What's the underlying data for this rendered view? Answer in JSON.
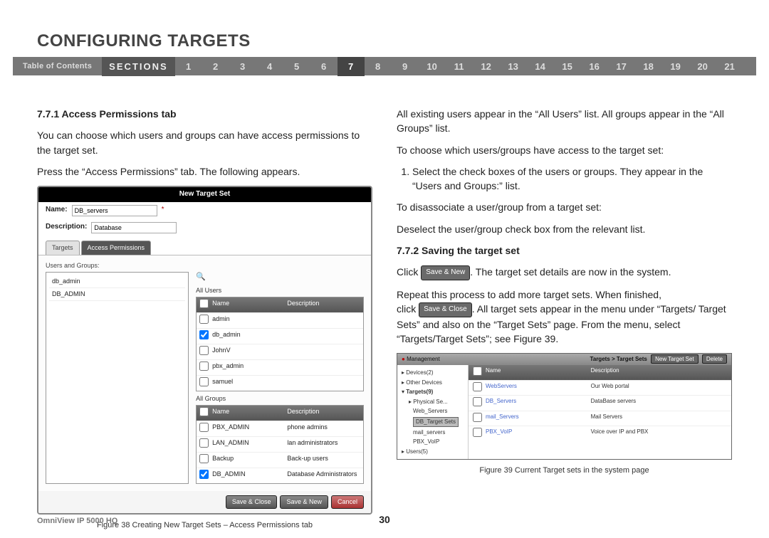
{
  "page_title": "CONFIGURING TARGETS",
  "nav": {
    "toc": "Table of Contents",
    "sections_label": "SECTIONS",
    "numbers": [
      "1",
      "2",
      "3",
      "4",
      "5",
      "6",
      "7",
      "8",
      "9",
      "10",
      "11",
      "12",
      "13",
      "14",
      "15",
      "16",
      "17",
      "18",
      "19",
      "20",
      "21"
    ],
    "active": "7"
  },
  "left": {
    "heading": "7.7.1 Access Permissions tab",
    "p1": "You can choose which users and groups can have access permissions to the target set.",
    "p2": "Press the “Access Permissions” tab. The following appears."
  },
  "fig38": {
    "titlebar": "New Target Set",
    "name_label": "Name:",
    "name_value": "DB_servers",
    "desc_label": "Description:",
    "desc_value": "Database",
    "tab_targets": "Targets",
    "tab_access": "Access Permissions",
    "users_and_groups_label": "Users and Groups:",
    "left_list": [
      "db_admin",
      "DB_ADMIN"
    ],
    "all_users_label": "All Users",
    "cols": {
      "name": "Name",
      "desc": "Description"
    },
    "all_users": [
      {
        "checked": false,
        "name": "admin",
        "desc": ""
      },
      {
        "checked": true,
        "name": "db_admin",
        "desc": ""
      },
      {
        "checked": false,
        "name": "JohnV",
        "desc": ""
      },
      {
        "checked": false,
        "name": "pbx_admin",
        "desc": ""
      },
      {
        "checked": false,
        "name": "samuel",
        "desc": ""
      }
    ],
    "all_groups_label": "All Groups",
    "all_groups": [
      {
        "checked": false,
        "name": "PBX_ADMIN",
        "desc": "phone admins"
      },
      {
        "checked": false,
        "name": "LAN_ADMIN",
        "desc": "lan administrators"
      },
      {
        "checked": false,
        "name": "Backup",
        "desc": "Back-up users"
      },
      {
        "checked": true,
        "name": "DB_ADMIN",
        "desc": "Database Administrators"
      }
    ],
    "buttons": {
      "save_close": "Save & Close",
      "save_new": "Save & New",
      "cancel": "Cancel"
    },
    "caption": "Figure 38 Creating New Target Sets – Access Permissions tab"
  },
  "right": {
    "p1": "All existing users appear in the “All Users” list. All groups appear in the “All Groups” list.",
    "p2": "To choose which users/groups have access to the target set:",
    "step1": "Select the check boxes of the users or groups. They appear in the “Users and Groups:” list.",
    "p3": "To disassociate a user/group from a target set:",
    "p4": "Deselect the user/group check box from the relevant list.",
    "heading2": "7.7.2 Saving the target set",
    "click_word": "Click",
    "save_new_btn": "Save & New",
    "after_save_new": ". The target set details are now in the system.",
    "p5": "Repeat this process to add more target sets. When finished,",
    "click_word2": "click",
    "save_close_btn": "Save & Close",
    "after_save_close": ". All target sets appear in the menu under “Targets/ Target Sets” and also on the “Target Sets” page. From the menu, select “Targets/Target Sets”; see Figure 39."
  },
  "fig39": {
    "management": "Management",
    "crumbs": "Targets > Target Sets",
    "new_btn": "New Target Set",
    "delete_btn": "Delete",
    "tree": {
      "devices": "Devices(2)",
      "other": "Other Devices",
      "targets": "Targets(9)",
      "physical": "Physical Se...",
      "web": "Web_Servers",
      "db": "DB_Target Sets",
      "mail": "mail_servers",
      "pbx": "PBX_VoIP",
      "users": "Users(5)"
    },
    "cols": {
      "name": "Name",
      "desc": "Description"
    },
    "rows": [
      {
        "name": "WebServers",
        "desc": "Our Web portal"
      },
      {
        "name": "DB_Servers",
        "desc": "DataBase servers"
      },
      {
        "name": "mail_Servers",
        "desc": "Mail Servers"
      },
      {
        "name": "PBX_VoIP",
        "desc": "Voice over IP and PBX"
      }
    ],
    "caption": "Figure 39 Current Target sets in the system page"
  },
  "footer": {
    "model": "OmniView IP 5000 HQ",
    "page": "30"
  }
}
